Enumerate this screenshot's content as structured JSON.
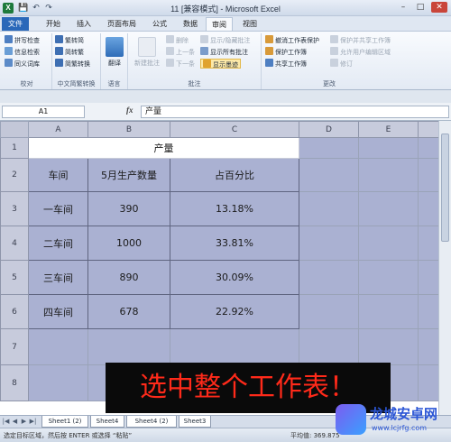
{
  "window": {
    "title": "11  [兼容模式] - Microsoft Excel",
    "app_icon": "X",
    "qat": {
      "save_icon": "💾",
      "undo_icon": "↶",
      "redo_icon": "↷"
    },
    "buttons": {
      "minimize": "–",
      "maximize": "□",
      "close": "✕"
    }
  },
  "tabs": [
    {
      "label": "文件"
    },
    {
      "label": "开始"
    },
    {
      "label": "插入"
    },
    {
      "label": "页面布局"
    },
    {
      "label": "公式"
    },
    {
      "label": "数据"
    },
    {
      "label": "审阅"
    },
    {
      "label": "视图"
    }
  ],
  "ribbon": {
    "proofing": {
      "label": "校对",
      "items": [
        "拼写检查",
        "信息检索",
        "同义词库"
      ]
    },
    "chinese": {
      "label": "中文简繁转换",
      "items": [
        "繁转简",
        "简转繁",
        "简繁转换"
      ]
    },
    "language": {
      "label": "语言",
      "translate": "翻译"
    },
    "comments": {
      "label": "批注",
      "new_comment": "新建批注",
      "items": [
        "删除",
        "上一条",
        "下一条"
      ],
      "show_items": [
        "显示/隐藏批注",
        "显示所有批注"
      ],
      "show_ink": "显示墨迹"
    },
    "changes": {
      "label": "更改",
      "items": [
        "撤消工作表保护",
        "保护工作簿",
        "共享工作簿"
      ],
      "right_items": [
        "保护并共享工作簿",
        "允许用户编辑区域",
        "修订"
      ]
    }
  },
  "formula_bar": {
    "name_box": "A1",
    "fx": "fx",
    "value": "产量"
  },
  "sheet": {
    "columns": [
      "A",
      "B",
      "C",
      "D",
      "E"
    ],
    "rows": [
      "1",
      "2",
      "3",
      "4",
      "5",
      "6",
      "7",
      "8"
    ],
    "title": "产量",
    "headers": [
      "车间",
      "5月生产数量",
      "占百分比"
    ],
    "data": [
      [
        "一车间",
        "390",
        "13.18%"
      ],
      [
        "二车间",
        "1000",
        "33.81%"
      ],
      [
        "三车间",
        "890",
        "30.09%"
      ],
      [
        "四车间",
        "678",
        "22.92%"
      ]
    ]
  },
  "banner": "选中整个工作表！",
  "sheet_tabs": [
    "Sheet1 (2)",
    "Sheet4",
    "Sheet4 (2)",
    "Sheet3"
  ],
  "status": {
    "text": "选定目标区域，然后按 ENTER 或选择 “粘贴”",
    "average": "平均值: 369.875"
  },
  "watermark": {
    "name": "龙城安卓网",
    "url": "www.lcjrfg.com"
  },
  "colors": {
    "selection": "#aab1d2",
    "banner_text": "#ff2a1a",
    "file_tab": "#2a68b9"
  }
}
